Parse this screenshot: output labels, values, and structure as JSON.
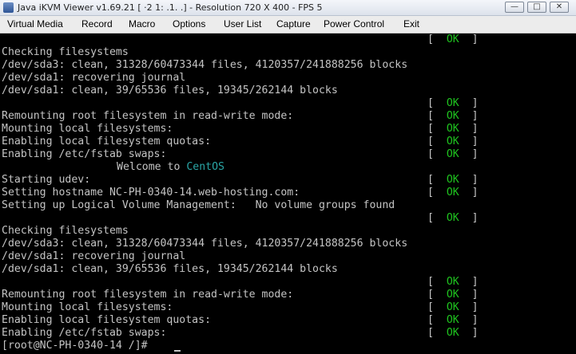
{
  "window": {
    "title": "Java iKVM Viewer v1.69.21 [ ·2 1: .1. .]   - Resolution 720 X 400 - FPS 5",
    "min_glyph": "—",
    "max_glyph": "□",
    "close_glyph": "✕"
  },
  "menu": [
    "Virtual Media",
    "Record",
    "Macro",
    "Options",
    "User List",
    "Capture",
    "Power Control",
    "Exit"
  ],
  "colors": {
    "ok": "#1fc41f",
    "console_text": "#c4c4c4",
    "centos": "#2aa6a6",
    "background": "#000000"
  },
  "console": {
    "status_bracket_open": "[",
    "status_ok": "OK",
    "status_bracket_close": "]",
    "lines": [
      "",
      "Checking filesystems",
      "/dev/sda3: clean, 31328/60473344 files, 4120357/241888256 blocks",
      "/dev/sda1: recovering journal",
      "/dev/sda1: clean, 39/65536 files, 19345/262144 blocks",
      "",
      "Remounting root filesystem in read-write mode:",
      "Mounting local filesystems:",
      "Enabling local filesystem quotas:",
      "Enabling /etc/fstab swaps:",
      "Welcome to ",
      "Starting udev:",
      "Setting hostname NC-PH-0340-14.web-hosting.com:",
      "Setting up Logical Volume Management:   No volume groups found",
      "",
      "Checking filesystems",
      "/dev/sda3: clean, 31328/60473344 files, 4120357/241888256 blocks",
      "/dev/sda1: recovering journal",
      "/dev/sda1: clean, 39/65536 files, 19345/262144 blocks",
      "",
      "Remounting root filesystem in read-write mode:",
      "Mounting local filesystems:",
      "Enabling local filesystem quotas:",
      "Enabling /etc/fstab swaps:",
      "[root@NC-PH-0340-14 /]# "
    ],
    "centos_word": "CentOS",
    "ok_rows": [
      0,
      5,
      6,
      7,
      8,
      9,
      11,
      12,
      14,
      19,
      20,
      21,
      22,
      23
    ]
  }
}
